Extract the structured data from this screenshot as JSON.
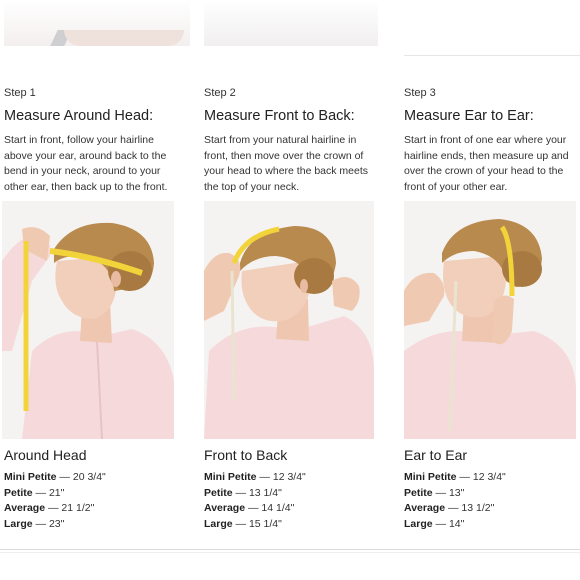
{
  "steps": [
    {
      "label": "Step 1",
      "title": "Measure Around Head:",
      "description": "Start in front, follow your hairline above your ear, around back to the bend in your neck, around to your other ear, then back up to the front.",
      "photo_icon": "woman-measuring-around-head",
      "size_title": "Around Head",
      "sizes": [
        {
          "name": "Mini Petite",
          "value": "20 3/4\""
        },
        {
          "name": "Petite",
          "value": "21\""
        },
        {
          "name": "Average",
          "value": "21 1/2\""
        },
        {
          "name": "Large",
          "value": "23\""
        }
      ]
    },
    {
      "label": "Step 2",
      "title": "Measure Front to Back:",
      "description": "Start from your natural hairline in front, then move over the crown of your head to where the back meets the top of your neck.",
      "photo_icon": "woman-measuring-front-to-back",
      "size_title": "Front to Back",
      "sizes": [
        {
          "name": "Mini Petite",
          "value": "12 3/4\""
        },
        {
          "name": "Petite",
          "value": "13 1/4\""
        },
        {
          "name": "Average",
          "value": "14 1/4\""
        },
        {
          "name": "Large",
          "value": "15 1/4\""
        }
      ]
    },
    {
      "label": "Step 3",
      "title": "Measure Ear to Ear:",
      "description": "Start in front of one ear where your hairline ends, then measure up and over the crown of your head to the front of your other ear.",
      "photo_icon": "woman-measuring-ear-to-ear",
      "size_title": "Ear to Ear",
      "sizes": [
        {
          "name": "Mini Petite",
          "value": "12 3/4\""
        },
        {
          "name": "Petite",
          "value": "13\""
        },
        {
          "name": "Average",
          "value": "13 1/2\""
        },
        {
          "name": "Large",
          "value": "14\""
        }
      ]
    }
  ],
  "separator": " — ",
  "colors": {
    "tape": "#f2d43a",
    "hair": "#b98a4e",
    "skin": "#f0cdb8",
    "shirt": "#f6dadb"
  }
}
